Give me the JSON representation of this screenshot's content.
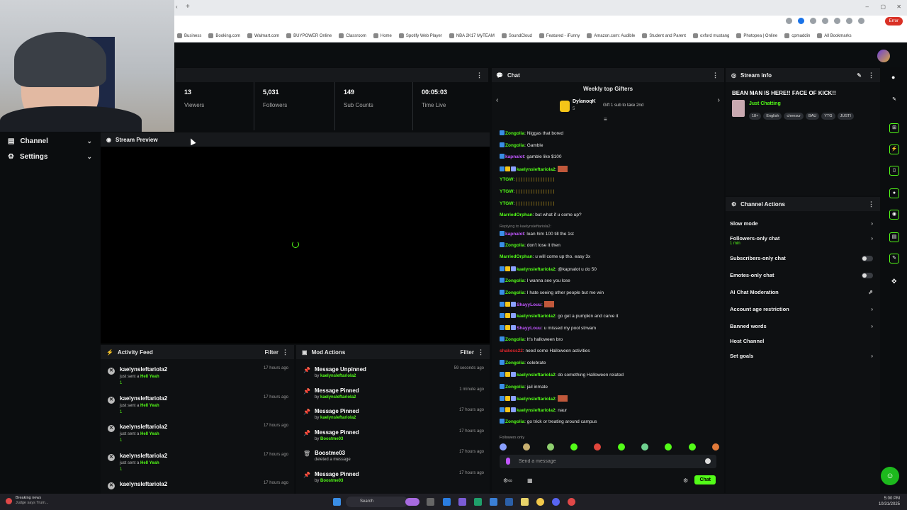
{
  "colors": {
    "accent": "#53fc18",
    "bg": "#0b0d0f",
    "panel": "#0e1012",
    "header": "#17191c",
    "error": "#d93025"
  },
  "browser": {
    "bookmarks": [
      "Business",
      "Booking.com",
      "Walmart.com",
      "BUYPOWER Online",
      "Classroom",
      "Home",
      "Spotify Web Player",
      "NBA 2K17 MyTEAM",
      "SoundCloud",
      "Featured - iFunny",
      "Amazon.com: Audible",
      "Student and Parent",
      "oxford mustang",
      "Photopea | Online",
      "cpmaddin",
      "All Bookmarks"
    ],
    "error_label": "Error"
  },
  "nav": {
    "channel": "Channel",
    "settings": "Settings"
  },
  "stats": [
    {
      "value": "13",
      "label": "Viewers"
    },
    {
      "value": "5,031",
      "label": "Followers"
    },
    {
      "value": "149",
      "label": "Sub Counts"
    },
    {
      "value": "00:05:03",
      "label": "Time Live"
    }
  ],
  "preview": {
    "title": "Stream Preview"
  },
  "activity": {
    "title": "Activity Feed",
    "filter": "Filter",
    "items": [
      {
        "user": "kaelynsleftariola2",
        "action": "just sent a",
        "gift": "Hell Yeah",
        "count": "1",
        "time": "17 hours ago"
      },
      {
        "user": "kaelynsleftariola2",
        "action": "just sent a",
        "gift": "Hell Yeah",
        "count": "1",
        "time": "17 hours ago"
      },
      {
        "user": "kaelynsleftariola2",
        "action": "just sent a",
        "gift": "Hell Yeah",
        "count": "1",
        "time": "17 hours ago"
      },
      {
        "user": "kaelynsleftariola2",
        "action": "just sent a",
        "gift": "Hell Yeah",
        "count": "1",
        "time": "17 hours ago"
      },
      {
        "user": "kaelynsleftariola2",
        "action": "",
        "gift": "",
        "count": "",
        "time": "17 hours ago"
      }
    ]
  },
  "mod": {
    "title": "Mod Actions",
    "filter": "Filter",
    "items": [
      {
        "title": "Message Unpinned",
        "prefix": "by",
        "user": "kaelynsleftariola2",
        "time": "59 seconds ago"
      },
      {
        "title": "Message Pinned",
        "prefix": "by",
        "user": "kaelynsleftariola2",
        "time": "1 minute ago"
      },
      {
        "title": "Message Pinned",
        "prefix": "by",
        "user": "kaelynsleftariola2",
        "time": "17 hours ago"
      },
      {
        "title": "Message Pinned",
        "prefix": "by",
        "user": "Boostme03",
        "time": "17 hours ago"
      },
      {
        "title": "Boostme03",
        "prefix": "deleted a message",
        "user": "",
        "time": "17 hours ago"
      },
      {
        "title": "Message Pinned",
        "prefix": "by",
        "user": "Boostme03",
        "time": "17 hours ago"
      }
    ]
  },
  "chat": {
    "title": "Chat",
    "gifters_title": "Weekly top Gifters",
    "top_gifter": "DylanoqK",
    "top_gifter_count": "5",
    "gift_cta": "Gift 1 sub to take 2nd",
    "messages": [
      {
        "user": "Zongolia",
        "color": "#53fc18",
        "text": "Niggas that bored"
      },
      {
        "user": "Zongolia",
        "color": "#53fc18",
        "text": "Gamble"
      },
      {
        "user": "kapnalot",
        "color": "#c156ff",
        "text": "gamble like $100"
      },
      {
        "user": "kaelynsleftariola2",
        "color": "#53fc18",
        "text": ""
      },
      {
        "user": "YTGW",
        "color": "#53fc18",
        "text": "| | | | | | | | | | | | | | | |"
      },
      {
        "user": "YTGW",
        "color": "#53fc18",
        "text": "| | | | | | | | | | | | | | | |"
      },
      {
        "user": "YTGW",
        "color": "#53fc18",
        "text": "| | | | | | | | | | | | | | | |"
      },
      {
        "user": "MarriedOrphan",
        "color": "#53fc18",
        "text": "but what if u come up?"
      },
      {
        "user": "kapnalot",
        "color": "#c156ff",
        "text": "loan him 100 till the 1st",
        "reply": "Replying to kaelynsleftariola2:"
      },
      {
        "user": "Zongolia",
        "color": "#53fc18",
        "text": "don't lose it then"
      },
      {
        "user": "MarriedOrphan",
        "color": "#53fc18",
        "text": "u will come up tho. easy 3x"
      },
      {
        "user": "kaelynsleftariola2",
        "color": "#53fc18",
        "text": "@kapnalot u do 50"
      },
      {
        "user": "Zongolia",
        "color": "#53fc18",
        "text": "I wanna see you lose"
      },
      {
        "user": "Zongolia",
        "color": "#53fc18",
        "text": "I hate seeing other people but me win"
      },
      {
        "user": "ShayyLouu",
        "color": "#c156ff",
        "text": ""
      },
      {
        "user": "kaelynsleftariola2",
        "color": "#53fc18",
        "text": "go get a pumpkin and carve it"
      },
      {
        "user": "ShayyLouu",
        "color": "#c156ff",
        "text": "u missed my pool strwam"
      },
      {
        "user": "Zongolia",
        "color": "#53fc18",
        "text": "It's halloween bro"
      },
      {
        "user": "shakess22",
        "color": "#e0262c",
        "text": "need some Halloween activities"
      },
      {
        "user": "Zongolia",
        "color": "#53fc18",
        "text": "celebrate"
      },
      {
        "user": "kaelynsleftariola2",
        "color": "#53fc18",
        "text": "do something Halloween related"
      },
      {
        "user": "Zongolia",
        "color": "#53fc18",
        "text": "jail inmate"
      },
      {
        "user": "kaelynsleftariola2",
        "color": "#53fc18",
        "text": ""
      },
      {
        "user": "kaelynsleftariola2",
        "color": "#53fc18",
        "text": "naur"
      },
      {
        "user": "Zongolia",
        "color": "#53fc18",
        "text": "go trick or treating around campus"
      }
    ],
    "followers_only": "Followers only",
    "input_placeholder": "Send a message",
    "send_label": "Chat"
  },
  "stream_info": {
    "title": "Stream info",
    "stream_title": "BEAN MAN IS HERE!! FACE OF KICK!!",
    "category": "Just Chatting",
    "tags": [
      "18+",
      "English",
      "cheesur",
      "BAU",
      "YTG",
      "JUSTI"
    ]
  },
  "channel_actions": {
    "title": "Channel Actions",
    "items": [
      {
        "label": "Slow mode",
        "sub": "",
        "control": "chevron"
      },
      {
        "label": "Followers-only chat",
        "sub": "1 min",
        "control": "chevron"
      },
      {
        "label": "Subscribers-only chat",
        "sub": "",
        "control": "toggle"
      },
      {
        "label": "Emotes-only chat",
        "sub": "",
        "control": "toggle"
      },
      {
        "label": "AI Chat Moderation",
        "sub": "",
        "control": "external"
      },
      {
        "label": "Account age restriction",
        "sub": "",
        "control": "chevron"
      },
      {
        "label": "Banned words",
        "sub": "",
        "control": "chevron"
      },
      {
        "label": "Host Channel",
        "sub": "",
        "control": "none"
      },
      {
        "label": "Set goals",
        "sub": "",
        "control": "chevron"
      }
    ]
  },
  "taskbar": {
    "news_title": "Breaking news",
    "news_sub": "Judge says Trum...",
    "search": "Search",
    "time": "5:00 PM",
    "date": "10/31/2025"
  }
}
